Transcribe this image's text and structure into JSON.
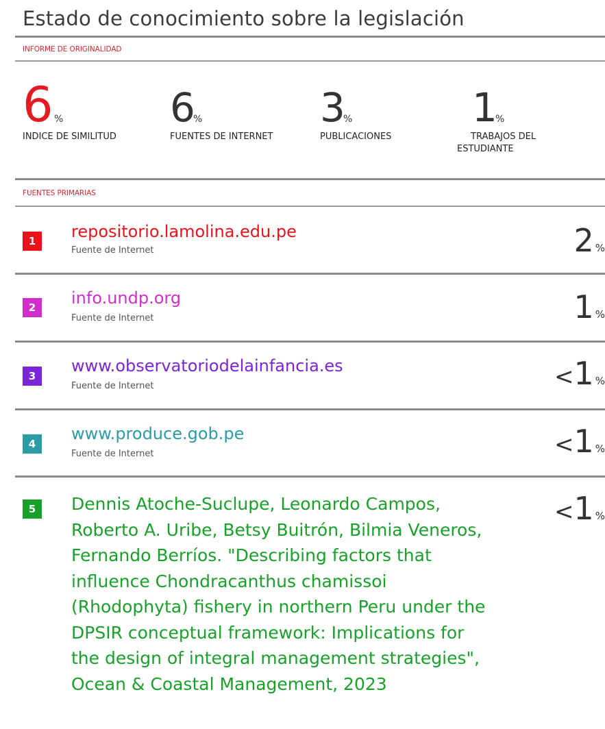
{
  "report": {
    "title": "Estado de conocimiento sobre la legislación",
    "originality_label": "INFORME DE ORIGINALIDAD",
    "primary_sources_label": "FUENTES PRIMARIAS"
  },
  "stats": [
    {
      "value": "6",
      "unit": "%",
      "label_line1": "INDICE DE SIMILITUD",
      "label_line2": ""
    },
    {
      "value": "6",
      "unit": "%",
      "label_line1": "FUENTES DE INTERNET",
      "label_line2": ""
    },
    {
      "value": "3",
      "unit": "%",
      "label_line1": "PUBLICACIONES",
      "label_line2": ""
    },
    {
      "value": "1",
      "unit": "%",
      "label_line1": "TRABAJOS DEL",
      "label_line2": "ESTUDIANTE"
    }
  ],
  "sources": [
    {
      "rank": "1",
      "title": "repositorio.lamolina.edu.pe",
      "type": "Fuente de Internet",
      "prefix": "",
      "value": "2",
      "unit": "%",
      "color": "#e8141c"
    },
    {
      "rank": "2",
      "title": "info.undp.org",
      "type": "Fuente de Internet",
      "prefix": "",
      "value": "1",
      "unit": "%",
      "color": "#d12fcd"
    },
    {
      "rank": "3",
      "title": "www.observatoriodelainfancia.es",
      "type": "Fuente de Internet",
      "prefix": "<",
      "value": "1",
      "unit": "%",
      "color": "#7b25d9"
    },
    {
      "rank": "4",
      "title": "www.produce.gob.pe",
      "type": "Fuente de Internet",
      "prefix": "<",
      "value": "1",
      "unit": "%",
      "color": "#2c9ba6"
    },
    {
      "rank": "5",
      "title": "Dennis Atoche-Suclupe, Leonardo Campos, Roberto A. Uribe, Betsy Buitrón, Bilmia Veneros, Fernando Berríos. \"Describing factors that influence Chondracanthus chamissoi (Rhodophyta) fishery in northern Peru under the DPSIR conceptual framework: Implications for the design of integral management strategies\", Ocean & Coastal Management, 2023",
      "type": "",
      "prefix": "<",
      "value": "1",
      "unit": "%",
      "color": "#19a02a"
    }
  ]
}
